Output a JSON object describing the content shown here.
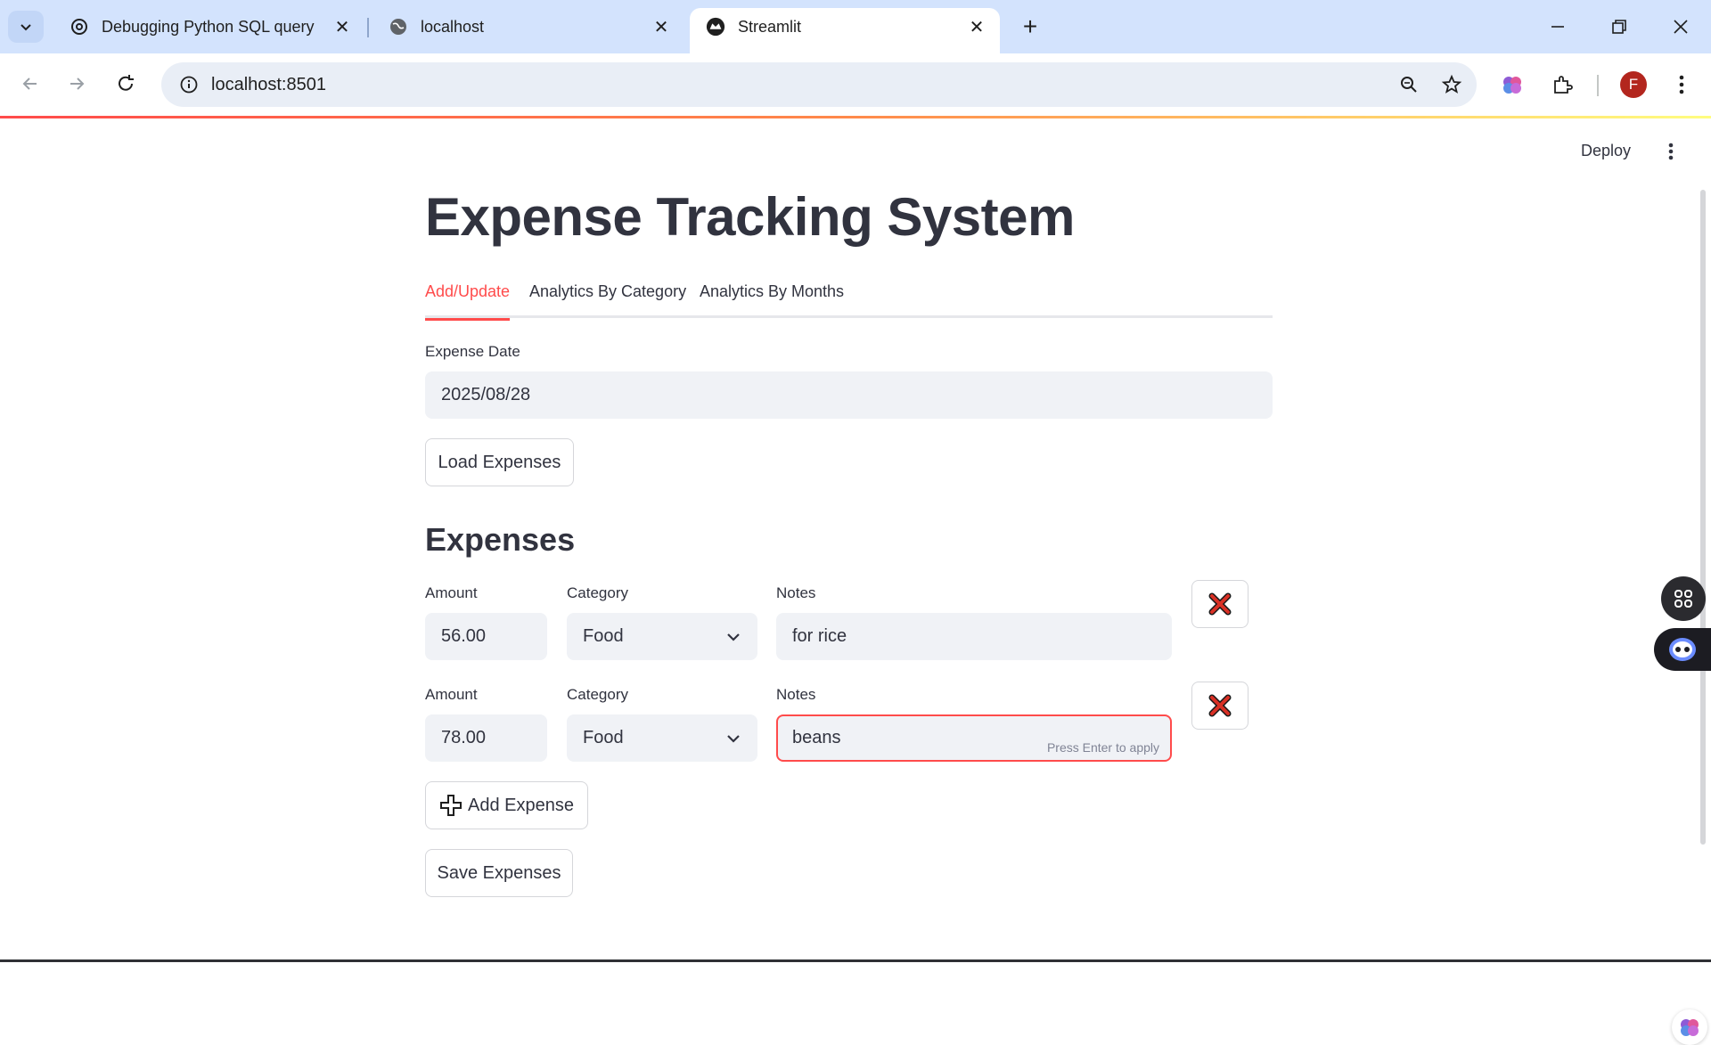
{
  "browser": {
    "tabs": [
      {
        "title": "Debugging Python SQL query",
        "favicon": "openai-icon"
      },
      {
        "title": "localhost",
        "favicon": "globe-icon"
      },
      {
        "title": "Streamlit",
        "favicon": "streamlit-icon"
      }
    ],
    "active_tab_index": 2,
    "url": "localhost:8501",
    "profile_initial": "F"
  },
  "app": {
    "deploy_label": "Deploy",
    "title": "Expense Tracking System",
    "tabs": [
      "Add/Update",
      "Analytics By Category",
      "Analytics By Months"
    ],
    "active_tab": "Add/Update",
    "date_label": "Expense Date",
    "date_value": "2025/08/28",
    "load_button": "Load Expenses",
    "expenses_heading": "Expenses",
    "rows": [
      {
        "amount_label": "Amount",
        "amount": "56.00",
        "category_label": "Category",
        "category": "Food",
        "notes_label": "Notes",
        "notes": "for rice"
      },
      {
        "amount_label": "Amount",
        "amount": "78.00",
        "category_label": "Category",
        "category": "Food",
        "notes_label": "Notes",
        "notes": "beans",
        "hint": "Press Enter to apply"
      }
    ],
    "add_button": "Add Expense",
    "save_button": "Save Expenses"
  },
  "colors": {
    "accent": "#ff4b4b",
    "text": "#31333f",
    "input_bg": "#f0f2f6",
    "tabstrip": "#d3e3fd"
  }
}
